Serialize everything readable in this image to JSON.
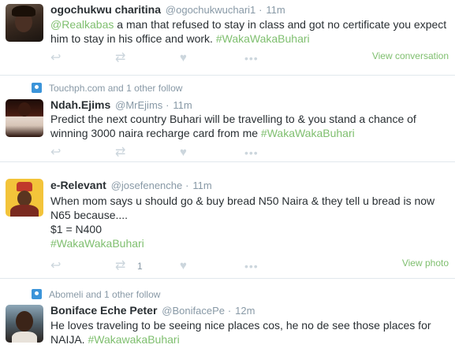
{
  "tweets": [
    {
      "name": "ogochukwu charitina",
      "handle": "@ogochukwuchari1",
      "dot": "·",
      "time": "11m",
      "text_mention": "@Realkabas",
      "text_body": " a man that refused to stay in class and got no certificate you expect him to stay in his office and work. ",
      "text_hashtag": "#WakaWakaBuhari",
      "view_link": "View conversation"
    },
    {
      "social_context": "Touchph.com and 1 other follow",
      "name": "Ndah.Ejims",
      "handle": "@MrEjims",
      "dot": "·",
      "time": "11m",
      "text_body": "Predict the next country Buhari will be travelling to & you stand a chance of winning 3000 naira recharge card from me ",
      "text_hashtag": "#WakaWakaBuhari"
    },
    {
      "name": "e-Relevant",
      "handle": "@josefenenche",
      "dot": "·",
      "time": "11m",
      "text_line1": "When mom says u should go & buy bread N50 Naira & they tell u bread is now N65 because....",
      "text_line2": "$1 = N400",
      "text_hashtag": "#WakaWakaBuhari",
      "retweet_count": "1",
      "view_link": "View photo"
    },
    {
      "social_context": "Abomeli and 1 other follow",
      "name": "Boniface Eche Peter",
      "handle": "@BonifacePe",
      "dot": "·",
      "time": "12m",
      "text_body": "He loves traveling to be seeing nice places cos, he no de see those places for NAIJA. ",
      "text_hashtag": "#WakawakaBuhari"
    }
  ],
  "icons": {
    "reply": "↩",
    "retweet": "⇄",
    "like": "♥",
    "more": "•••",
    "social": "person-icon"
  },
  "colors": {
    "hashtag": "#7fbf6f",
    "secondary_text": "#8899a6",
    "action_icon": "#ccd6dd",
    "social_icon": "#3b94d9",
    "border": "#e1e8ed"
  }
}
